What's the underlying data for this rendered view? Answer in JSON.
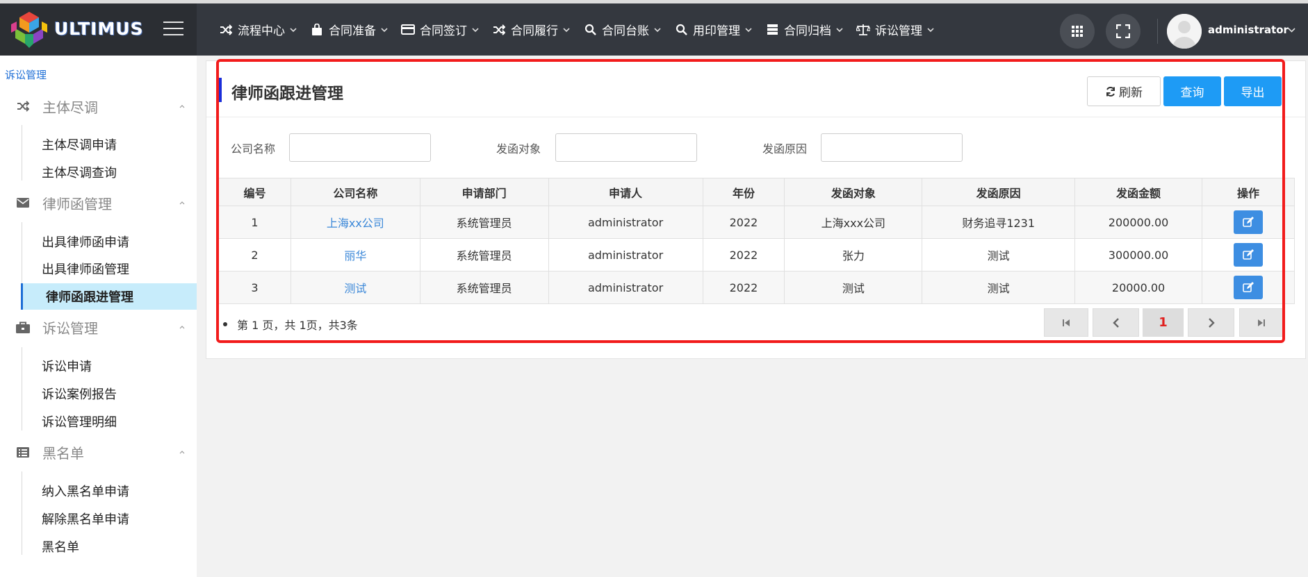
{
  "brand": {
    "logo_text": "ULTIMUS"
  },
  "topnav": [
    {
      "label": "流程中心",
      "icon": "shuffle-icon"
    },
    {
      "label": "合同准备",
      "icon": "bag-icon"
    },
    {
      "label": "合同签订",
      "icon": "card-icon"
    },
    {
      "label": "合同履行",
      "icon": "shuffle-icon"
    },
    {
      "label": "合同台账",
      "icon": "search-icon"
    },
    {
      "label": "用印管理",
      "icon": "search-icon"
    },
    {
      "label": "合同归档",
      "icon": "server-icon"
    },
    {
      "label": "诉讼管理",
      "icon": "scale-icon"
    }
  ],
  "user": {
    "name": "administrator"
  },
  "sidebar": {
    "root": "诉讼管理",
    "groups": [
      {
        "label": "主体尽调",
        "icon": "shuffle-icon",
        "items": [
          "主体尽调申请",
          "主体尽调查询"
        ]
      },
      {
        "label": "律师函管理",
        "icon": "envelope-icon",
        "items": [
          "出具律师函申请",
          "出具律师函管理",
          "律师函跟进管理"
        ]
      },
      {
        "label": "诉讼管理",
        "icon": "briefcase-icon",
        "items": [
          "诉讼申请",
          "诉讼案例报告",
          "诉讼管理明细"
        ]
      },
      {
        "label": "黑名单",
        "icon": "list-icon",
        "items": [
          "纳入黑名单申请",
          "解除黑名单申请",
          "黑名单"
        ]
      }
    ],
    "active_item": "律师函跟进管理"
  },
  "page": {
    "title": "律师函跟进管理",
    "buttons": {
      "refresh": "刷新",
      "query": "查询",
      "export": "导出"
    }
  },
  "filters": [
    {
      "label": "公司名称",
      "value": ""
    },
    {
      "label": "发函对象",
      "value": ""
    },
    {
      "label": "发函原因",
      "value": ""
    }
  ],
  "table": {
    "headers": [
      "编号",
      "公司名称",
      "申请部门",
      "申请人",
      "年份",
      "发函对象",
      "发函原因",
      "发函金额",
      "操作"
    ],
    "rows": [
      [
        "1",
        "上海xx公司",
        "系统管理员",
        "administrator",
        "2022",
        "上海xxx公司",
        "财务追寻1231",
        "200000.00"
      ],
      [
        "2",
        "丽华",
        "系统管理员",
        "administrator",
        "2022",
        "张力",
        "测试",
        "300000.00"
      ],
      [
        "3",
        "测试",
        "系统管理员",
        "administrator",
        "2022",
        "测试",
        "测试",
        "20000.00"
      ]
    ]
  },
  "pager": {
    "info": "第 1 页，共 1页，共3条",
    "current": "1"
  },
  "colors": {
    "accent": "#1e9bf5",
    "topbar": "#34383f",
    "active_bg": "#c7ecfb",
    "highlight_frame": "#f21b1b"
  }
}
